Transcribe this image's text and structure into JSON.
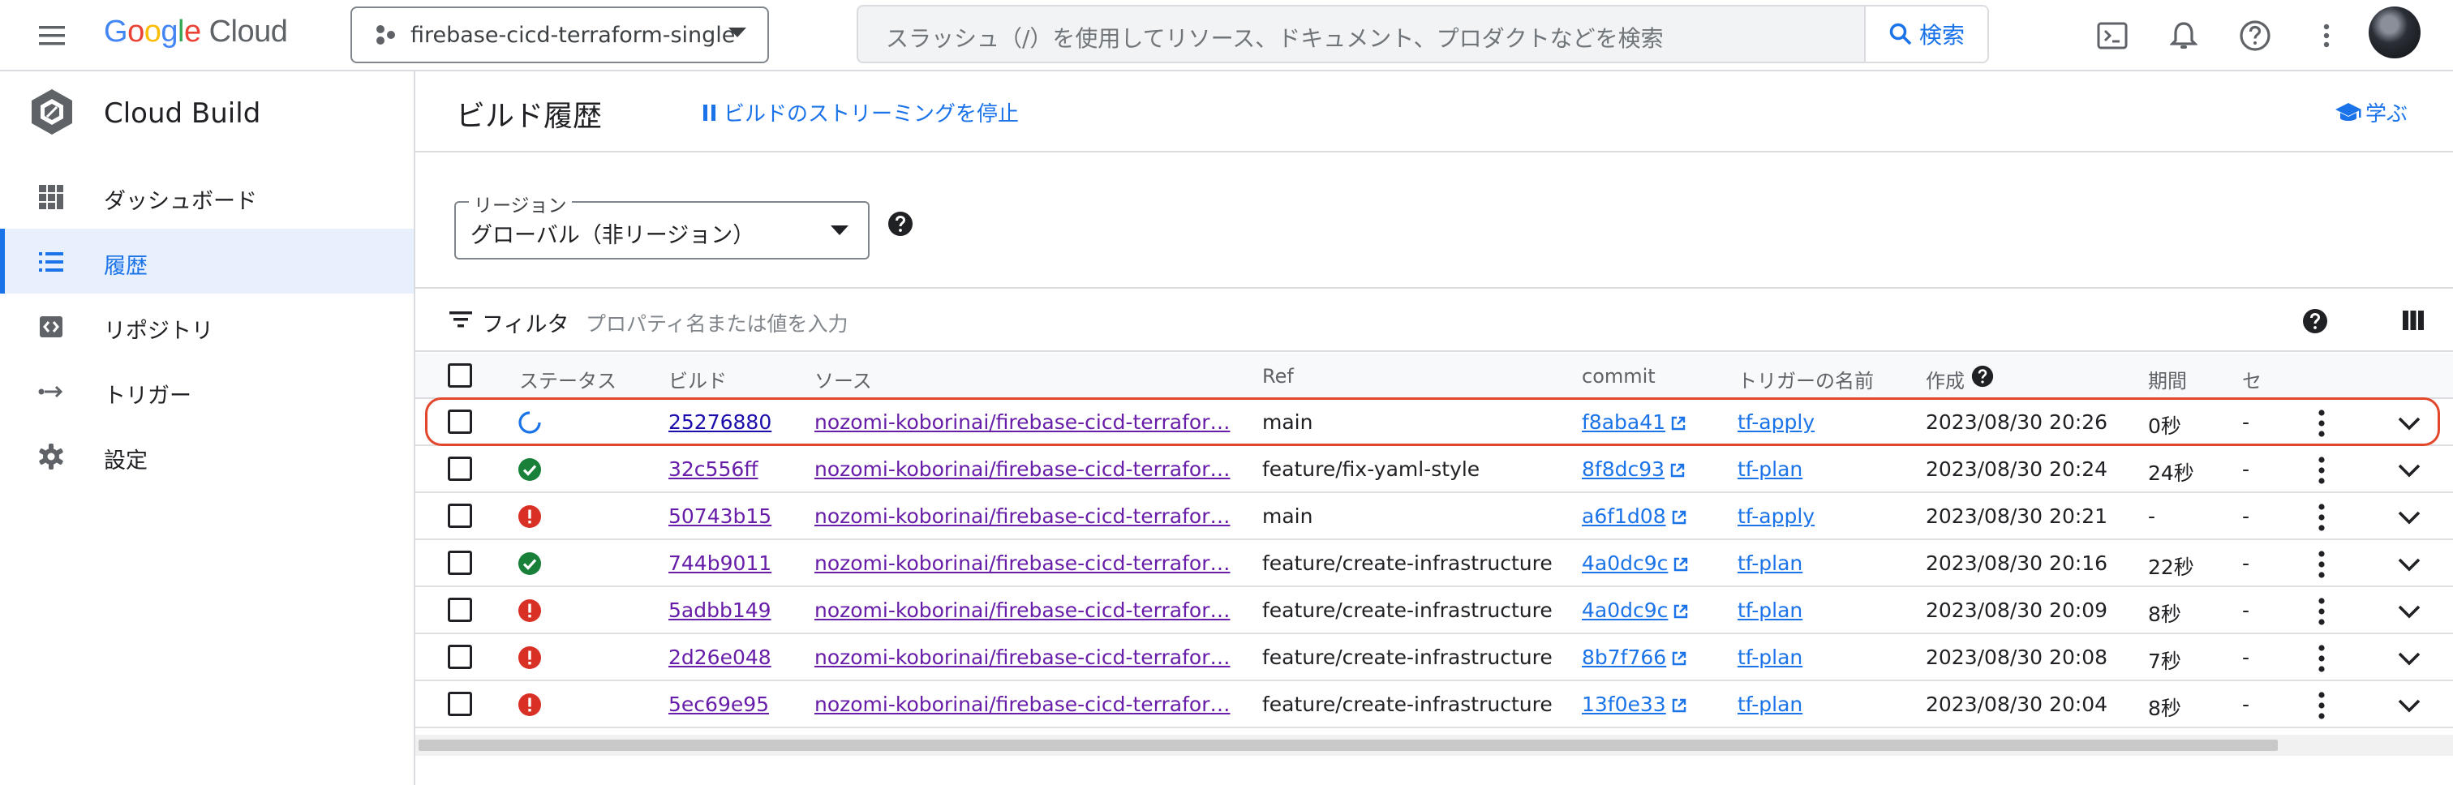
{
  "topbar": {
    "logo_google": "Google",
    "logo_cloud": "Cloud",
    "project_name": "firebase-cicd-terraform-single",
    "search_placeholder": "スラッシュ（/）を使用してリソース、ドキュメント、プロダクトなどを検索",
    "search_button": "検索",
    "icons": [
      "cloud-shell-icon",
      "bell-icon",
      "help-icon",
      "more-vert-icon"
    ]
  },
  "sidebar": {
    "product_name": "Cloud Build",
    "items": [
      {
        "label": "ダッシュボード",
        "icon": "dashboard-icon"
      },
      {
        "label": "履歴",
        "icon": "list-icon",
        "active": true
      },
      {
        "label": "リポジトリ",
        "icon": "repository-icon"
      },
      {
        "label": "トリガー",
        "icon": "trigger-icon"
      },
      {
        "label": "設定",
        "icon": "gear-icon"
      }
    ]
  },
  "main": {
    "title": "ビルド履歴",
    "stream_button": "ビルドのストリーミングを停止",
    "learn_button": "学ぶ",
    "region_label": "リージョン",
    "region_value": "グローバル（非リージョン）",
    "filter_label": "フィルタ",
    "filter_placeholder": "プロパティ名または値を入力"
  },
  "table": {
    "columns": {
      "status": "ステータス",
      "build": "ビルド",
      "source": "ソース",
      "ref": "Ref",
      "commit": "commit",
      "trigger": "トリガーの名前",
      "created": "作成",
      "duration": "期間",
      "more": "セ"
    },
    "rows": [
      {
        "status": "running",
        "build": "25276880",
        "source": "nozomi-koborinai/firebase-cicd-terrafor…",
        "ref": "main",
        "commit": "f8aba41",
        "trigger": "tf-apply",
        "created": "2023/08/30 20:26",
        "duration": "0秒",
        "extra": "-"
      },
      {
        "status": "success",
        "build": "32c556ff",
        "source": "nozomi-koborinai/firebase-cicd-terrafor…",
        "ref": "feature/fix-yaml-style",
        "commit": "8f8dc93",
        "trigger": "tf-plan",
        "created": "2023/08/30 20:24",
        "duration": "24秒",
        "extra": "-"
      },
      {
        "status": "error",
        "build": "50743b15",
        "source": "nozomi-koborinai/firebase-cicd-terrafor…",
        "ref": "main",
        "commit": "a6f1d08",
        "trigger": "tf-apply",
        "created": "2023/08/30 20:21",
        "duration": "-",
        "extra": "-"
      },
      {
        "status": "success",
        "build": "744b9011",
        "source": "nozomi-koborinai/firebase-cicd-terrafor…",
        "ref": "feature/create-infrastructure",
        "commit": "4a0dc9c",
        "trigger": "tf-plan",
        "created": "2023/08/30 20:16",
        "duration": "22秒",
        "extra": "-"
      },
      {
        "status": "error",
        "build": "5adbb149",
        "source": "nozomi-koborinai/firebase-cicd-terrafor…",
        "ref": "feature/create-infrastructure",
        "commit": "4a0dc9c",
        "trigger": "tf-plan",
        "created": "2023/08/30 20:09",
        "duration": "8秒",
        "extra": "-"
      },
      {
        "status": "error",
        "build": "2d26e048",
        "source": "nozomi-koborinai/firebase-cicd-terrafor…",
        "ref": "feature/create-infrastructure",
        "commit": "8b7f766",
        "trigger": "tf-plan",
        "created": "2023/08/30 20:08",
        "duration": "7秒",
        "extra": "-"
      },
      {
        "status": "error",
        "build": "5ec69e95",
        "source": "nozomi-koborinai/firebase-cicd-terrafor…",
        "ref": "feature/create-infrastructure",
        "commit": "13f0e33",
        "trigger": "tf-plan",
        "created": "2023/08/30 20:04",
        "duration": "8秒",
        "extra": "-"
      }
    ]
  },
  "colors": {
    "accent": "#1a73e8",
    "success": "#188038",
    "error": "#d93025",
    "highlight": "#e2472b"
  }
}
